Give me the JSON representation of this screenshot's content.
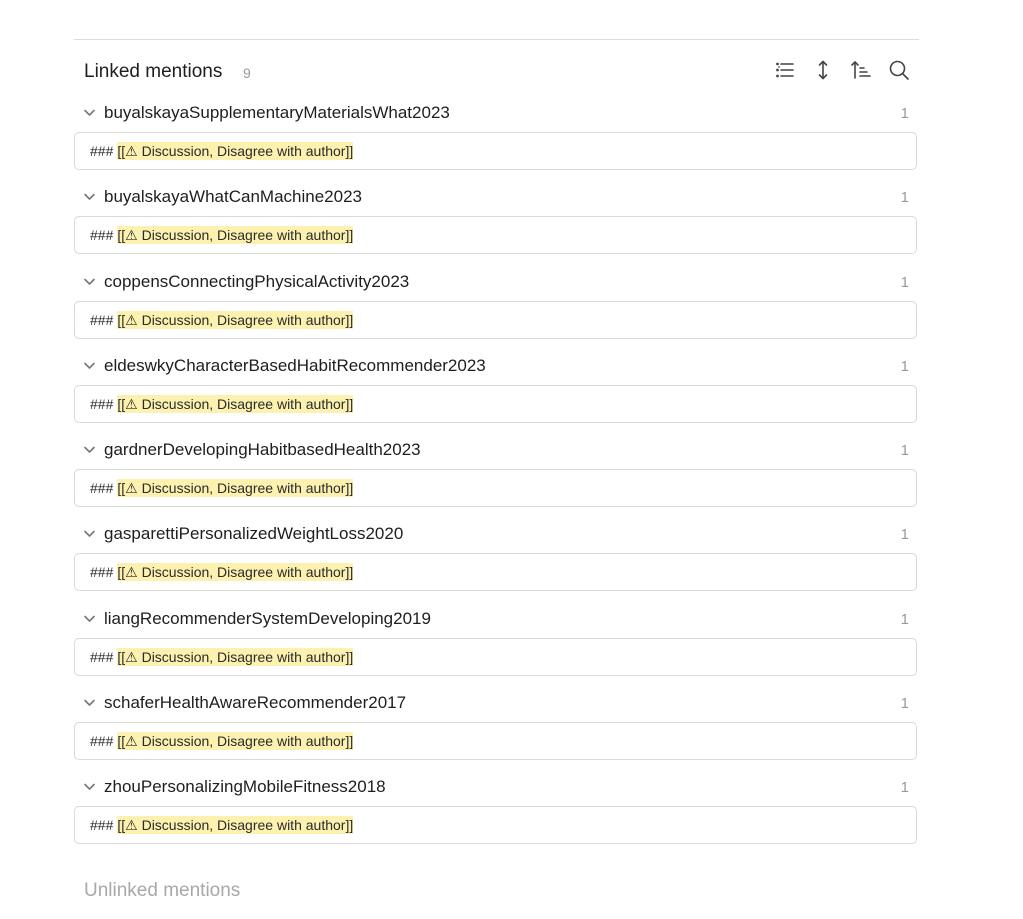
{
  "linked_mentions": {
    "title": "Linked mentions",
    "count": "9",
    "toolbar": {
      "icons": [
        "list-icon",
        "expand-collapse-icon",
        "sort-icon",
        "search-icon"
      ]
    },
    "results": [
      {
        "title": "buyalskayaSupplementaryMaterialsWhat2023",
        "count": "1",
        "snippet_prefix": "###",
        "snippet_highlight": "[[⚠ Discussion, Disagree with author]]"
      },
      {
        "title": "buyalskayaWhatCanMachine2023",
        "count": "1",
        "snippet_prefix": "###",
        "snippet_highlight": "[[⚠ Discussion, Disagree with author]]"
      },
      {
        "title": "coppensConnectingPhysicalActivity2023",
        "count": "1",
        "snippet_prefix": "###",
        "snippet_highlight": "[[⚠ Discussion, Disagree with author]]"
      },
      {
        "title": "eldeswkyCharacterBasedHabitRecommender2023",
        "count": "1",
        "snippet_prefix": "###",
        "snippet_highlight": "[[⚠ Discussion, Disagree with author]]"
      },
      {
        "title": "gardnerDevelopingHabitbasedHealth2023",
        "count": "1",
        "snippet_prefix": "###",
        "snippet_highlight": "[[⚠ Discussion, Disagree with author]]"
      },
      {
        "title": "gasparettiPersonalizedWeightLoss2020",
        "count": "1",
        "snippet_prefix": "###",
        "snippet_highlight": "[[⚠ Discussion, Disagree with author]]"
      },
      {
        "title": "liangRecommenderSystemDeveloping2019",
        "count": "1",
        "snippet_prefix": "###",
        "snippet_highlight": "[[⚠ Discussion, Disagree with author]]"
      },
      {
        "title": "schaferHealthAwareRecommender2017",
        "count": "1",
        "snippet_prefix": "###",
        "snippet_highlight": "[[⚠ Discussion, Disagree with author]]"
      },
      {
        "title": "zhouPersonalizingMobileFitness2018",
        "count": "1",
        "snippet_prefix": "###",
        "snippet_highlight": "[[⚠ Discussion, Disagree with author]]"
      }
    ]
  },
  "unlinked_mentions": {
    "title": "Unlinked mentions"
  },
  "colors": {
    "highlight": "#fdf1b0",
    "divider": "#dddddd",
    "muted_text": "#9a9a9a"
  }
}
